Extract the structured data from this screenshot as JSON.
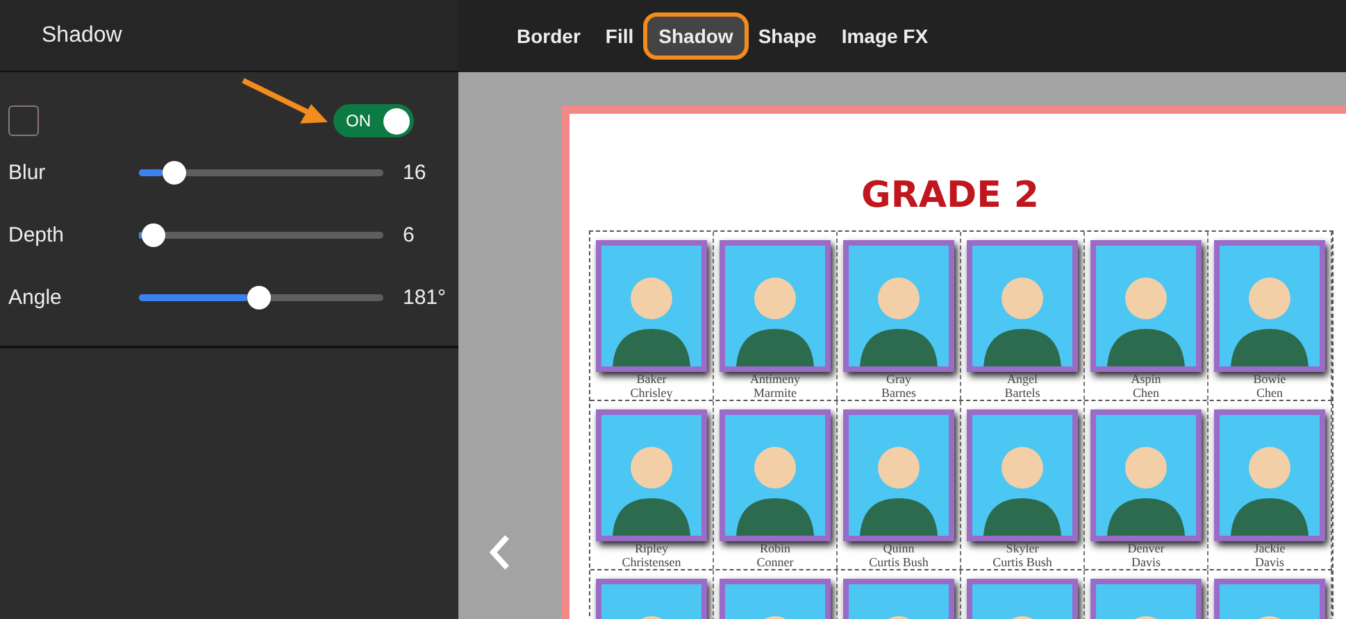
{
  "panel": {
    "title": "Shadow",
    "toggle": {
      "label": "ON",
      "on": true
    },
    "sliders": [
      {
        "label": "Blur",
        "level": 0.11,
        "reading": "16"
      },
      {
        "label": "Depth",
        "level": 0.01,
        "reading": "6"
      },
      {
        "label": "Angle",
        "level": 0.49,
        "reading": "181°"
      }
    ]
  },
  "tabs": [
    {
      "label": "Border",
      "selected": false
    },
    {
      "label": "Fill",
      "selected": false
    },
    {
      "label": "Shadow",
      "selected": true
    },
    {
      "label": "Shape",
      "selected": false
    },
    {
      "label": "Image FX",
      "selected": false
    }
  ],
  "page": {
    "title": "GRADE 2",
    "rows": [
      {
        "students": [
          {
            "kind": "named",
            "name": "Baker",
            "surname": "Chrisley"
          },
          {
            "kind": "named",
            "name": "Antimeny",
            "surname": "Marmite"
          },
          {
            "kind": "named",
            "name": "Gray",
            "surname": "Barnes"
          },
          {
            "kind": "named",
            "name": "Angel",
            "surname": "Bartels"
          },
          {
            "kind": "named",
            "name": "Aspin",
            "surname": "Chen"
          },
          {
            "kind": "named",
            "name": "Bowie",
            "surname": "Chen"
          }
        ]
      },
      {
        "students": [
          {
            "kind": "named",
            "name": "Ripley",
            "surname": "Christensen"
          },
          {
            "kind": "named",
            "name": "Robin",
            "surname": "Conner"
          },
          {
            "kind": "named",
            "name": "Quinn",
            "surname": "Curtis Bush"
          },
          {
            "kind": "named",
            "name": "Skyler",
            "surname": "Curtis Bush"
          },
          {
            "kind": "named",
            "name": "Denver",
            "surname": "Davis"
          },
          {
            "kind": "named",
            "name": "Jackie",
            "surname": "Davis"
          }
        ]
      },
      {
        "students": [
          {
            "kind": "photo"
          },
          {
            "kind": "photo"
          },
          {
            "kind": "photo"
          },
          {
            "kind": "photo"
          },
          {
            "kind": "photo"
          },
          {
            "kind": "photo"
          }
        ]
      }
    ]
  }
}
